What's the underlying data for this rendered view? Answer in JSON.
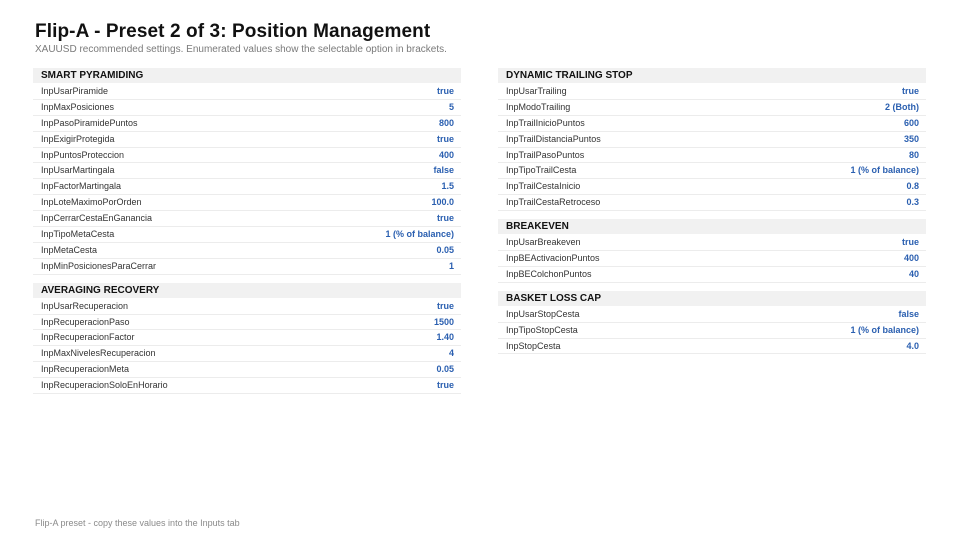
{
  "title": "Flip-A - Preset 2 of 3: Position Management",
  "subtitle": "XAUUSD recommended settings. Enumerated values show the selectable option in brackets.",
  "footer": "Flip-A preset - copy these values into the Inputs tab",
  "left_sections": [
    {
      "id": "smart-pyramiding",
      "title": "SMART PYRAMIDING",
      "rows": [
        {
          "key": "InpUsarPiramide",
          "value": "true"
        },
        {
          "key": "InpMaxPosiciones",
          "value": "5"
        },
        {
          "key": "InpPasoPiramidePuntos",
          "value": "800"
        },
        {
          "key": "InpExigirProtegida",
          "value": "true"
        },
        {
          "key": "InpPuntosProteccion",
          "value": "400"
        },
        {
          "key": "InpUsarMartingala",
          "value": "false"
        },
        {
          "key": "InpFactorMartingala",
          "value": "1.5"
        },
        {
          "key": "InpLoteMaximoPorOrden",
          "value": "100.0"
        },
        {
          "key": "InpCerrarCestaEnGanancia",
          "value": "true"
        },
        {
          "key": "InpTipoMetaCesta",
          "value": "1  (% of balance)"
        },
        {
          "key": "InpMetaCesta",
          "value": "0.05"
        },
        {
          "key": "InpMinPosicionesParaCerrar",
          "value": "1"
        }
      ]
    },
    {
      "id": "averaging-recovery",
      "title": "AVERAGING RECOVERY",
      "rows": [
        {
          "key": "InpUsarRecuperacion",
          "value": "true"
        },
        {
          "key": "InpRecuperacionPaso",
          "value": "1500"
        },
        {
          "key": "InpRecuperacionFactor",
          "value": "1.40"
        },
        {
          "key": "InpMaxNivelesRecuperacion",
          "value": "4"
        },
        {
          "key": "InpRecuperacionMeta",
          "value": "0.05"
        },
        {
          "key": "InpRecuperacionSoloEnHorario",
          "value": "true"
        }
      ]
    }
  ],
  "right_sections": [
    {
      "id": "dynamic-trailing-stop",
      "title": "DYNAMIC TRAILING STOP",
      "rows": [
        {
          "key": "InpUsarTrailing",
          "value": "true"
        },
        {
          "key": "InpModoTrailing",
          "value": "2  (Both)"
        },
        {
          "key": "InpTrailInicioPuntos",
          "value": "600"
        },
        {
          "key": "InpTrailDistanciaPuntos",
          "value": "350"
        },
        {
          "key": "InpTrailPasoPuntos",
          "value": "80"
        },
        {
          "key": "InpTipoTrailCesta",
          "value": "1  (% of balance)"
        },
        {
          "key": "InpTrailCestaInicio",
          "value": "0.8"
        },
        {
          "key": "InpTrailCestaRetroceso",
          "value": "0.3"
        }
      ]
    },
    {
      "id": "breakeven",
      "title": "BREAKEVEN",
      "rows": [
        {
          "key": "InpUsarBreakeven",
          "value": "true"
        },
        {
          "key": "InpBEActivacionPuntos",
          "value": "400"
        },
        {
          "key": "InpBEColchonPuntos",
          "value": "40"
        }
      ]
    },
    {
      "id": "basket-loss-cap",
      "title": "BASKET LOSS CAP",
      "rows": [
        {
          "key": "InpUsarStopCesta",
          "value": "false"
        },
        {
          "key": "InpTipoStopCesta",
          "value": "1  (% of balance)"
        },
        {
          "key": "InpStopCesta",
          "value": "4.0"
        }
      ]
    }
  ]
}
